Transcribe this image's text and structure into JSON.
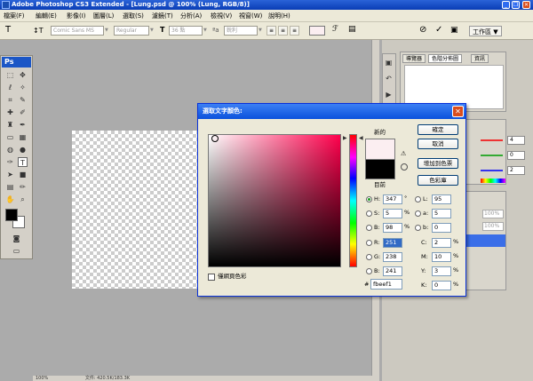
{
  "window": {
    "title": "Adobe Photoshop CS3 Extended - [Lung.psd @ 100% (Lung, RGB/8)]",
    "min": "_",
    "restore": "❐",
    "close": "✕"
  },
  "menu": [
    "檔案(F)",
    "編輯(E)",
    "影像(I)",
    "圖層(L)",
    "選取(S)",
    "濾鏡(T)",
    "分析(A)",
    "檢視(V)",
    "視窗(W)",
    "說明(H)"
  ],
  "options_bar": {
    "font_family": "Comic Sans MS",
    "font_style": "Regular",
    "font_size": "36 點",
    "antialias": "銳利",
    "workspace": "工作區"
  },
  "toolbox": {
    "logo": "Ps"
  },
  "status": {
    "zoom": "100%",
    "doc": "文件: 420.5K/183.3K"
  },
  "panels": {
    "tabs": [
      "導覽器",
      "色階分佈圖",
      "資訊"
    ],
    "color_values": [
      "4",
      "0",
      "2"
    ],
    "opacity": "100%",
    "fill": "100%"
  },
  "dialog": {
    "title": "選取文字顏色:",
    "new_label": "新的",
    "current_label": "目前",
    "buttons": {
      "ok": "確定",
      "cancel": "取消",
      "add_swatch": "增加到色票",
      "libraries": "色彩庫"
    },
    "web_only_label": "僅網頁色彩",
    "hsb": {
      "h": "347",
      "s": "5",
      "b": "98",
      "h_unit": "°",
      "s_unit": "%",
      "b_unit": "%"
    },
    "lab": {
      "l": "95",
      "a": "5",
      "b": "0"
    },
    "rgb": {
      "r": "251",
      "g": "238",
      "b": "241"
    },
    "cmyk": {
      "c": "2",
      "m": "10",
      "y": "3",
      "k": "0",
      "unit": "%"
    },
    "hex": "fbeef1",
    "hex_prefix": "#",
    "labels": {
      "H": "H:",
      "S": "S:",
      "B": "B:",
      "R": "R:",
      "G": "G:",
      "Bl": "B:",
      "L": "L:",
      "a": "a:",
      "b": "b:",
      "C": "C:",
      "M": "M:",
      "Y": "Y:",
      "K": "K:"
    }
  },
  "colors": {
    "new_color": "#fbeef1",
    "current_color": "#000000",
    "titlebar": "#0a51dc"
  }
}
